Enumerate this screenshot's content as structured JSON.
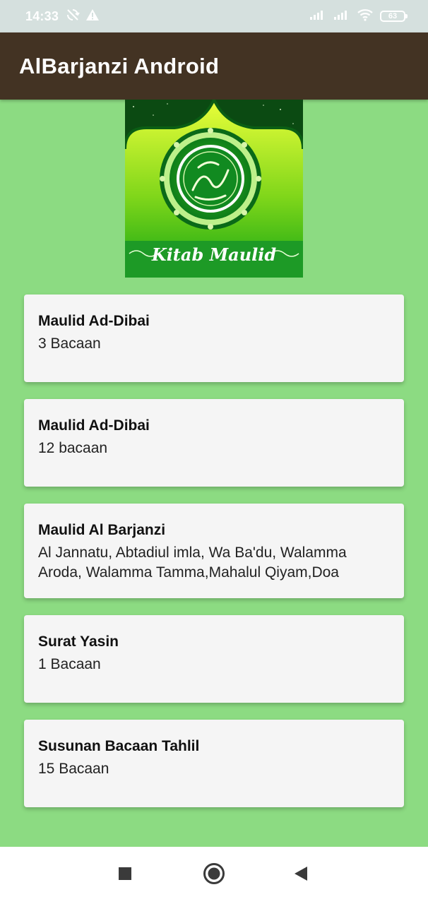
{
  "status_bar": {
    "time": "14:33",
    "battery": "63",
    "icons": [
      "sync-off-icon",
      "warning-icon",
      "signal-icon",
      "signal-icon",
      "wifi-icon",
      "battery-icon"
    ]
  },
  "app_bar": {
    "title": "AlBarjanzi Android"
  },
  "banner": {
    "caption": "Kitab Maulid",
    "arabic_text": "محمد المصطفى"
  },
  "cards": [
    {
      "title": "Maulid Ad-Dibai",
      "subtitle": "3 Bacaan"
    },
    {
      "title": "Maulid Ad-Dibai",
      "subtitle": "12 bacaan"
    },
    {
      "title": "Maulid Al Barjanzi",
      "subtitle": "Al Jannatu, Abtadiul imla, Wa Ba'du, Walamma Aroda, Walamma Tamma,Mahalul Qiyam,Doa"
    },
    {
      "title": "Surat Yasin",
      "subtitle": "1 Bacaan"
    },
    {
      "title": "Susunan Bacaan Tahlil",
      "subtitle": "15 Bacaan"
    }
  ],
  "nav_bar": {
    "icons": [
      "recents-square-icon",
      "home-circle-icon",
      "back-triangle-icon"
    ]
  },
  "colors": {
    "app_bar": "#433323",
    "background": "#8cdb82",
    "card": "#f5f5f5",
    "status_bar": "#d5e0de"
  }
}
